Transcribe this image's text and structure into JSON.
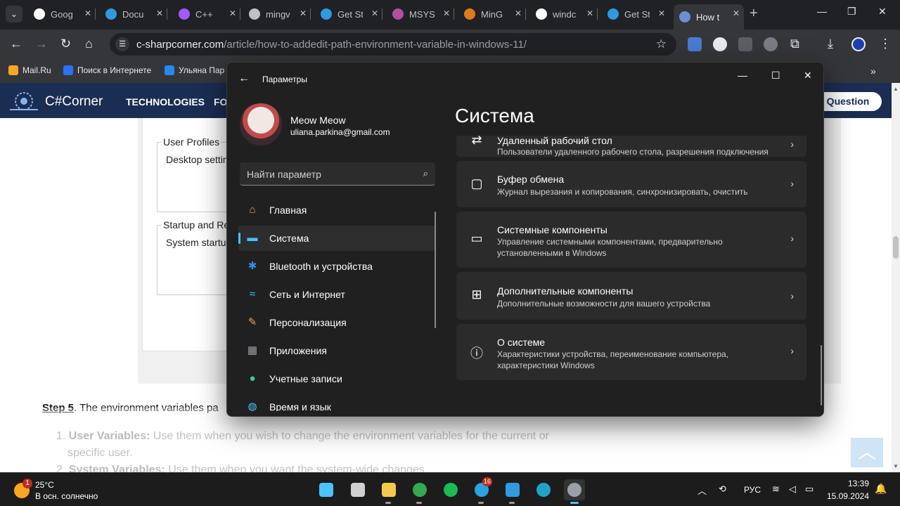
{
  "browser": {
    "tabs": [
      {
        "label": "Goog",
        "icon": "google-icon",
        "color": "#ffffff"
      },
      {
        "label": "Docu",
        "icon": "vscode-icon",
        "color": "#2f9ae0"
      },
      {
        "label": "C++",
        "icon": "cpp-icon",
        "color": "#a259ff"
      },
      {
        "label": "mingv",
        "icon": "globe-icon",
        "color": "#bdc1c6"
      },
      {
        "label": "Get St",
        "icon": "vscode-icon",
        "color": "#2f9ae0"
      },
      {
        "label": "MSYS",
        "icon": "msys-icon",
        "color": "#b24ea0"
      },
      {
        "label": "MinG",
        "icon": "mingw-icon",
        "color": "#e07b1a"
      },
      {
        "label": "windc",
        "icon": "google-icon",
        "color": "#ffffff"
      },
      {
        "label": "Get St",
        "icon": "vscode-icon",
        "color": "#2f9ae0"
      },
      {
        "label": "How t",
        "icon": "csharpcorner-icon",
        "color": "#6b8fd6"
      }
    ],
    "url_host": "c-sharpcorner.com",
    "url_path": "/article/how-to-addedit-path-environment-variable-in-windows-11/",
    "bookmarks": [
      {
        "label": "Mail.Ru",
        "color": "#f5a623"
      },
      {
        "label": "Поиск в Интернете",
        "color": "#2d6ff7"
      },
      {
        "label": "Ульяна Пар",
        "color": "#2787f5"
      }
    ],
    "more_bookmarks": "»"
  },
  "site": {
    "brand": "C#Corner",
    "nav": [
      "TECHNOLOGIES",
      "FO"
    ],
    "ask_button": "k Question",
    "dialog": {
      "group1_title": "User Profiles",
      "group1_value": "Desktop setting",
      "group2_title": "Startup and Rec",
      "group2_value": "System startup,"
    },
    "step_label": "Step 5",
    "step_text": ". The environment variables pa",
    "list": [
      {
        "num": "1.",
        "bold": "User Variables:",
        "text": " Use them when you wish to change the environment variables for the current or",
        "cont": "specific user."
      },
      {
        "num": "2.",
        "bold": "System Variables:",
        "text": " Use them when you want the system-wide changes"
      }
    ]
  },
  "settings": {
    "window_title": "Параметры",
    "user_name": "Meow Meow",
    "user_email": "uliana.parkina@gmail.com",
    "search_placeholder": "Найти параметр",
    "nav": [
      {
        "label": "Главная",
        "icon": "home-icon",
        "color": "#e9a25a"
      },
      {
        "label": "Система",
        "icon": "monitor-icon",
        "color": "#4cc2ff"
      },
      {
        "label": "Bluetooth и устройства",
        "icon": "bluetooth-icon",
        "color": "#2b8ff0"
      },
      {
        "label": "Сеть и Интернет",
        "icon": "wifi-icon",
        "color": "#4cc2ff"
      },
      {
        "label": "Персонализация",
        "icon": "brush-icon",
        "color": "#e9a25a"
      },
      {
        "label": "Приложения",
        "icon": "apps-icon",
        "color": "#9aa0a6"
      },
      {
        "label": "Учетные записи",
        "icon": "person-icon",
        "color": "#3ecf8e"
      },
      {
        "label": "Время и язык",
        "icon": "globe-icon",
        "color": "#4cc2ff"
      }
    ],
    "page_title": "Система",
    "cards": [
      {
        "title": "Удаленный рабочий стол",
        "subtitle": "Пользователи удаленного рабочего стола, разрешения подключения",
        "icon": "remote-desktop-icon"
      },
      {
        "title": "Буфер обмена",
        "subtitle": "Журнал вырезания и копирования, синхронизировать, очистить",
        "icon": "clipboard-icon"
      },
      {
        "title": "Системные компоненты",
        "subtitle": "Управление системными компонентами, предварительно установленными в Windows",
        "icon": "system-components-icon"
      },
      {
        "title": "Дополнительные компоненты",
        "subtitle": "Дополнительные возможности для вашего устройства",
        "icon": "optional-features-icon"
      },
      {
        "title": "О системе",
        "subtitle": "Характеристики устройства, переименование компьютера, характеристики Windows",
        "icon": "info-icon"
      }
    ]
  },
  "taskbar": {
    "weather_temp": "25°C",
    "weather_text": "В осн. солнечно",
    "weather_badge": "1",
    "telegram_badge": "16",
    "lang": "РУС",
    "time": "13:39",
    "date": "15.09.2024",
    "apps": [
      {
        "name": "start-button",
        "color": "#4cc2ff"
      },
      {
        "name": "task-view-button",
        "color": "#d0d0d0"
      },
      {
        "name": "file-explorer-icon",
        "color": "#f2c94c"
      },
      {
        "name": "chrome-icon",
        "color": "#34a853"
      },
      {
        "name": "spotify-icon",
        "color": "#1db954"
      },
      {
        "name": "telegram-icon",
        "color": "#2aa3df"
      },
      {
        "name": "vscode-icon",
        "color": "#2f9ae0"
      },
      {
        "name": "edge-icon",
        "color": "#1fa3c9"
      },
      {
        "name": "settings-icon",
        "color": "#9aa0a6"
      }
    ]
  }
}
